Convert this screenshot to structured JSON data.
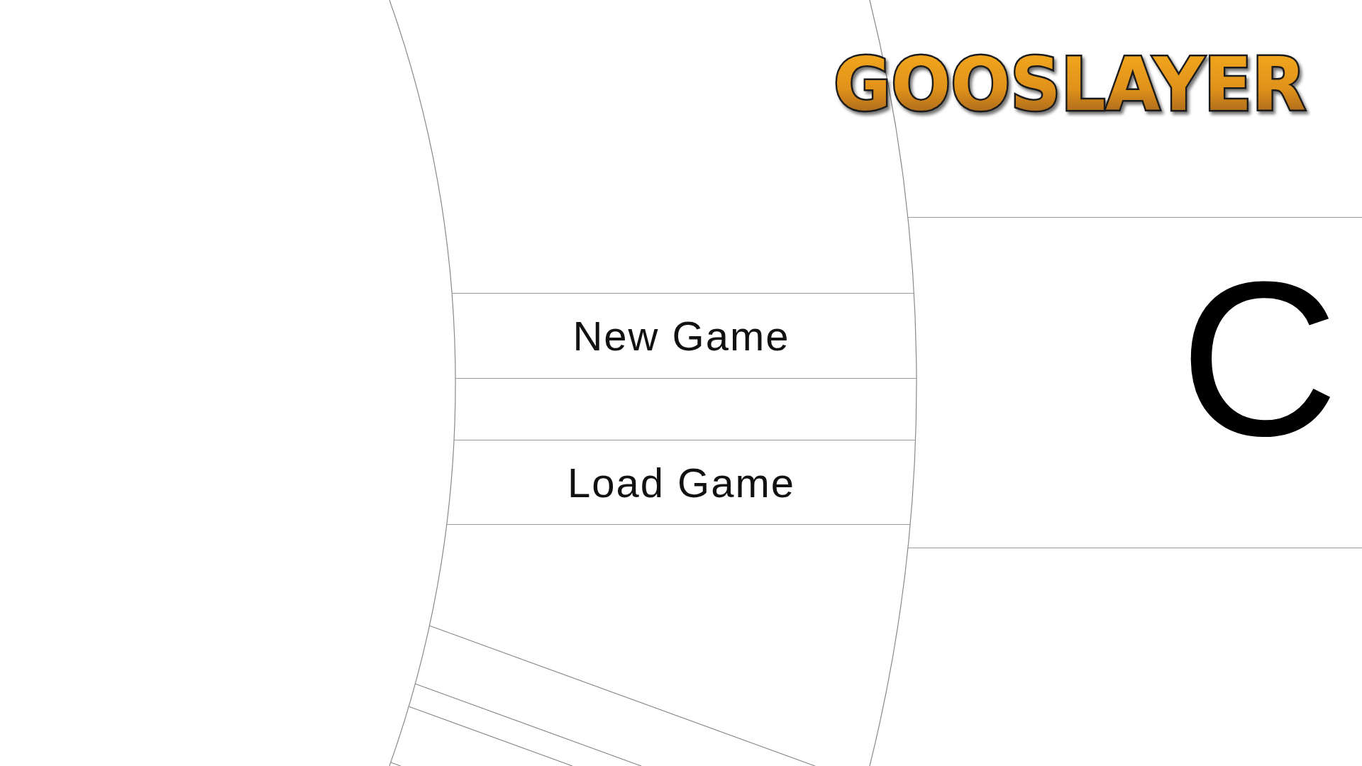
{
  "logo": {
    "text": "GOOSLAYER"
  },
  "menu_items": [
    {
      "label": "New Game"
    },
    {
      "label": "Load Game"
    }
  ],
  "featured_item": {
    "label": "C"
  }
}
